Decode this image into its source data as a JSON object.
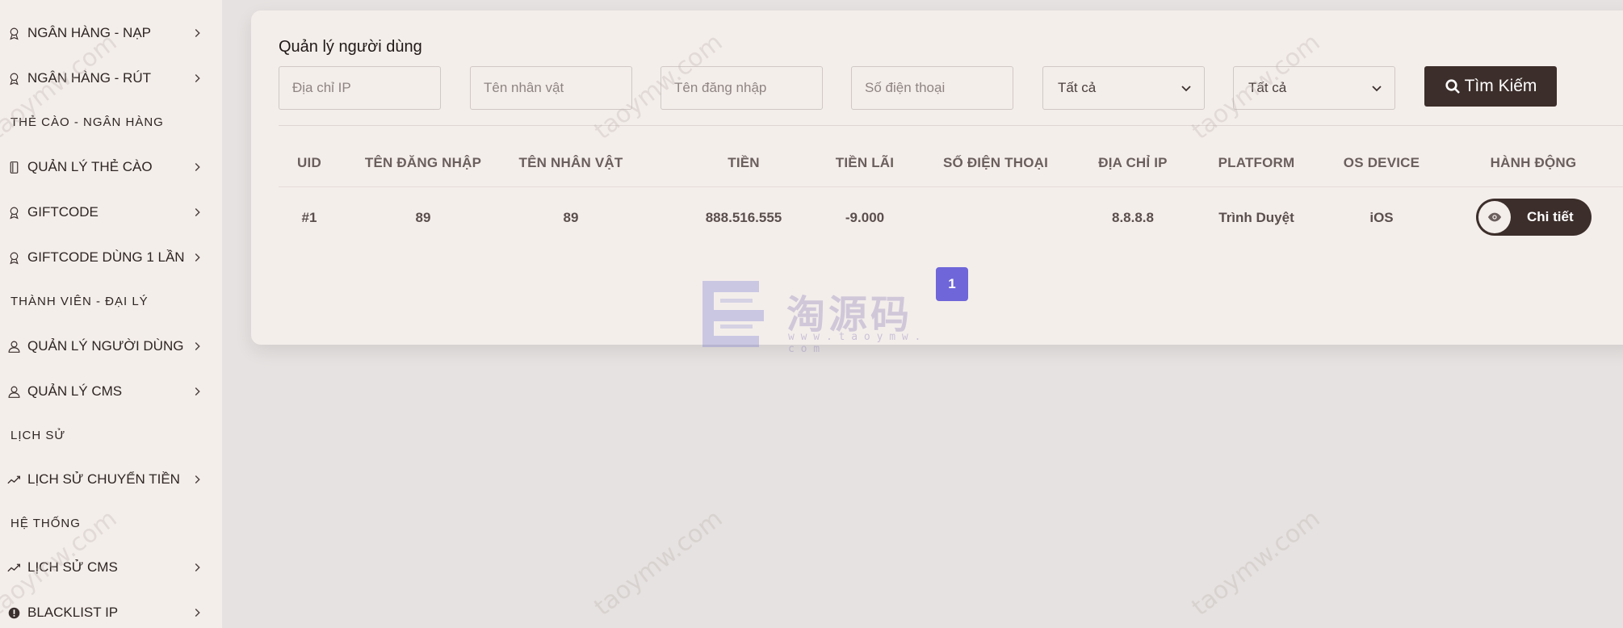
{
  "sidebar": {
    "items": [
      {
        "label": "NGÂN HÀNG - NẠP",
        "icon": "award-icon"
      },
      {
        "label": "NGÂN HÀNG - RÚT",
        "icon": "award-icon"
      },
      {
        "label": "QUẢN LÝ THẺ CÀO",
        "icon": "phone-icon"
      },
      {
        "label": "GIFTCODE",
        "icon": "award-icon"
      },
      {
        "label": "GIFTCODE DÙNG 1 LẦN",
        "icon": "award-icon"
      },
      {
        "label": "QUẢN LÝ NGƯỜI DÙNG",
        "icon": "user-icon"
      },
      {
        "label": "QUẢN LÝ CMS",
        "icon": "user-icon"
      },
      {
        "label": "LỊCH SỬ CHUYỂN TIỀN",
        "icon": "trend-icon"
      },
      {
        "label": "LỊCH SỬ CMS",
        "icon": "trend-icon"
      },
      {
        "label": "BLACKLIST IP",
        "icon": "alert-icon"
      }
    ],
    "headings": [
      "THẺ CÀO - NGÂN HÀNG",
      "THÀNH VIÊN - ĐẠI LÝ",
      "LỊCH SỬ",
      "HỆ THỐNG"
    ]
  },
  "main": {
    "title": "Quản lý người dùng",
    "filters": {
      "ip_placeholder": "Địa chỉ IP",
      "character_placeholder": "Tên nhân vật",
      "username_placeholder": "Tên đăng nhập",
      "phone_placeholder": "Số điện thoại",
      "select1_value": "Tất cả",
      "select2_value": "Tất cả"
    },
    "search_label": "Tìm Kiếm",
    "table": {
      "columns": [
        "UID",
        "TÊN ĐĂNG NHẬP",
        "TÊN NHÂN VẬT",
        "TIỀN",
        "TIỀN LÃI",
        "SỐ ĐIỆN THOẠI",
        "ĐỊA CHỈ IP",
        "PLATFORM",
        "OS DEVICE",
        "HÀNH ĐỘNG"
      ],
      "rows": [
        {
          "uid": "#1",
          "username": "89",
          "character": "89",
          "money": "888.516.555",
          "interest": "-9.000",
          "phone": "",
          "ip": "8.8.8.8",
          "platform": "Trình Duyệt",
          "os": "iOS",
          "action": "Chi tiết"
        }
      ]
    },
    "pagination": {
      "current": "1"
    }
  },
  "watermark": {
    "logo_text": "淘源码",
    "logo_url": "w w w . t a o y m w . c o m",
    "repeat_text": "taoymw.com"
  },
  "colors": {
    "sidebar_bg": "#f4eeeb",
    "page_bg": "#e6e2e1",
    "dark_button": "#3c2e2a",
    "pagination_active": "#6f66d9"
  }
}
